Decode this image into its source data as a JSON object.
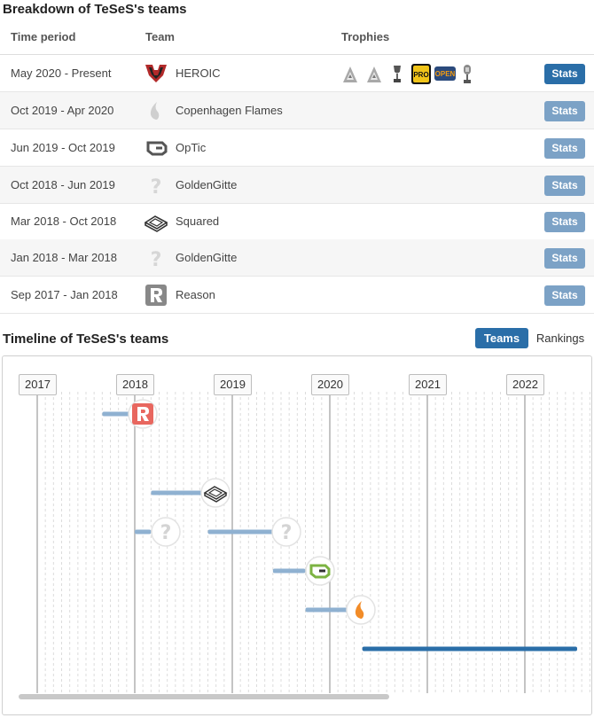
{
  "breakdown": {
    "title": "Breakdown of TeSeS's teams",
    "headers": {
      "period": "Time period",
      "team": "Team",
      "trophies": "Trophies"
    },
    "rows": [
      {
        "period": "May 2020 - Present",
        "team": "HEROIC",
        "icon": "heroic-logo-icon",
        "stats": "Stats"
      },
      {
        "period": "Oct 2019 - Apr 2020",
        "team": "Copenhagen Flames",
        "icon": "flame-logo-icon",
        "stats": "Stats"
      },
      {
        "period": "Jun 2019 - Oct 2019",
        "team": "OpTic",
        "icon": "optic-logo-icon",
        "stats": "Stats"
      },
      {
        "period": "Oct 2018 - Jun 2019",
        "team": "GoldenGitte",
        "icon": "question-mark-icon",
        "stats": "Stats"
      },
      {
        "period": "Mar 2018 - Oct 2018",
        "team": "Squared",
        "icon": "squared-logo-icon",
        "stats": "Stats"
      },
      {
        "period": "Jan 2018 - Mar 2018",
        "team": "GoldenGitte",
        "icon": "question-mark-icon",
        "stats": "Stats"
      },
      {
        "period": "Sep 2017 - Jan 2018",
        "team": "Reason",
        "icon": "reason-logo-icon",
        "stats": "Stats"
      }
    ],
    "trophy_icons": [
      "blast-trophy-icon",
      "blast-trophy-icon",
      "cup-trophy-icon",
      "esl-pro-league-icon",
      "dreamhack-open-icon",
      "mic-trophy-icon"
    ],
    "trophy_texts": {
      "esl": "PRO",
      "open": "OPEN"
    }
  },
  "timeline": {
    "title": "Timeline of TeSeS's teams",
    "tabs": {
      "teams": "Teams",
      "rankings": "Rankings"
    },
    "years": [
      "2017",
      "2018",
      "2019",
      "2020",
      "2021",
      "2022"
    ],
    "stints": [
      {
        "team": "Reason",
        "start": "Sep 2017",
        "end": "Jan 2018"
      },
      {
        "team": "Squared",
        "start": "Mar 2018",
        "end": "Oct 2018"
      },
      {
        "team": "GoldenGitte",
        "start": "Jan 2018",
        "end": "Mar 2018"
      },
      {
        "team": "GoldenGitte",
        "start": "Oct 2018",
        "end": "Jun 2019"
      },
      {
        "team": "OpTic",
        "start": "Jun 2019",
        "end": "Oct 2019"
      },
      {
        "team": "Copenhagen Flames",
        "start": "Oct 2019",
        "end": "Apr 2020"
      },
      {
        "team": "HEROIC",
        "start": "May 2020",
        "end": "Present"
      }
    ]
  },
  "colors": {
    "primary_button": "#2a6ea8",
    "secondary_button": "#7ca2c6",
    "bar_past": "#8fb1d1",
    "bar_current": "#2a6ea8",
    "reason_red": "#e8675f"
  }
}
